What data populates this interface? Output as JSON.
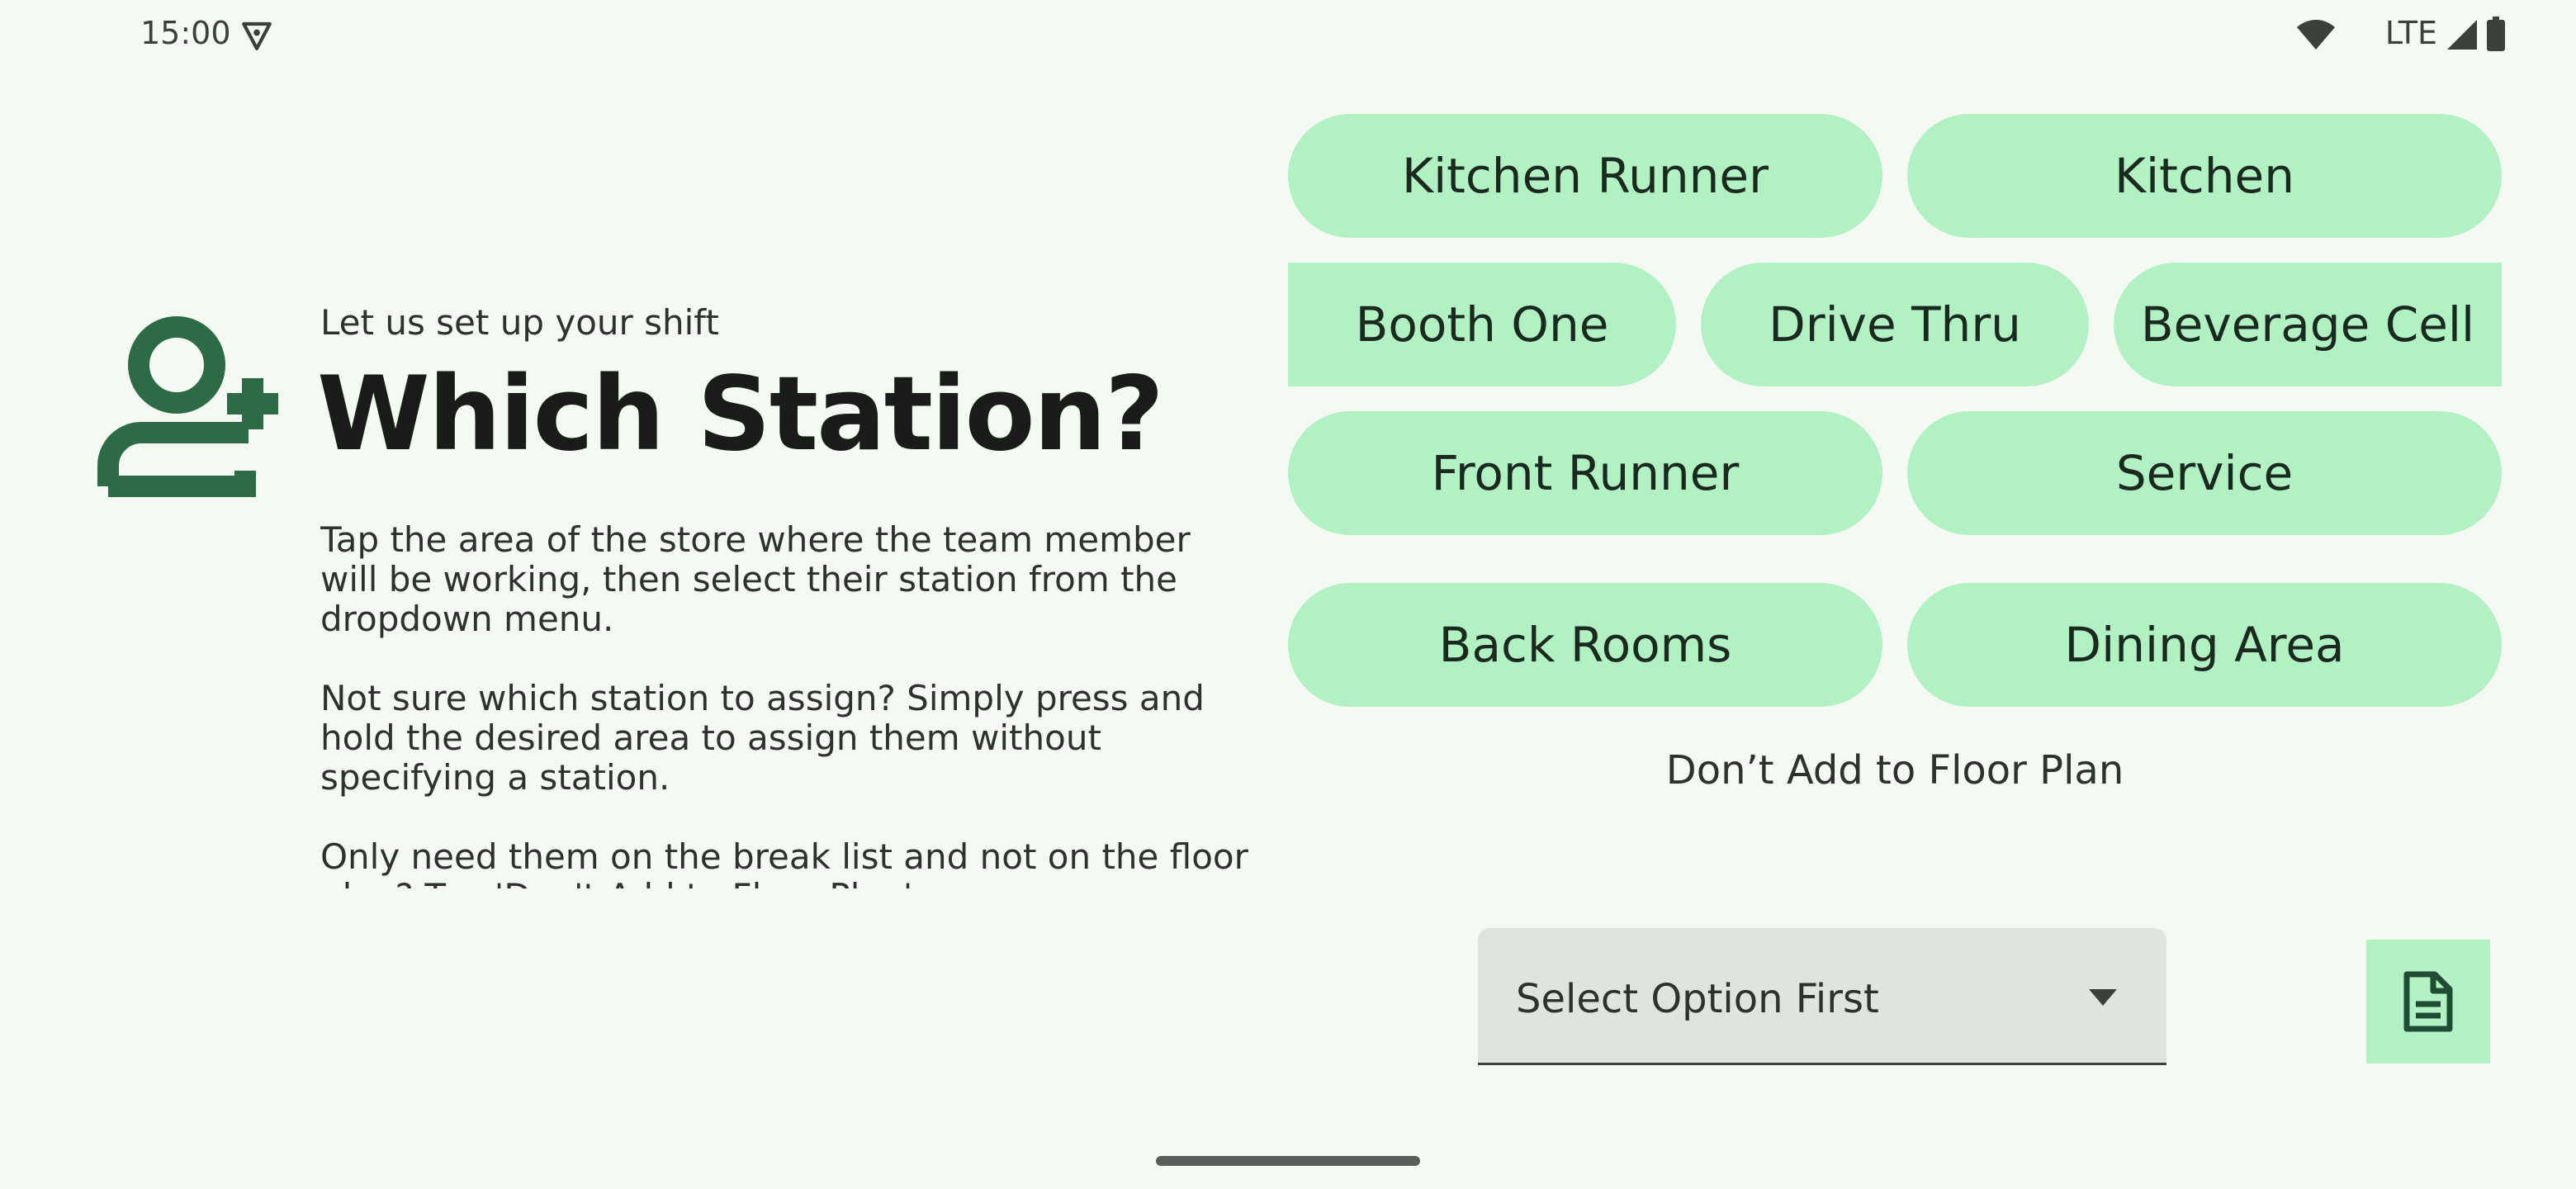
{
  "status_bar": {
    "time": "15:00",
    "network": "LTE",
    "icons": [
      "vpn-icon",
      "wifi-icon",
      "signal-icon",
      "battery-icon"
    ]
  },
  "header": {
    "subtitle": "Let us set up your shift",
    "title": "Which Station?",
    "icon": "person-add-icon"
  },
  "description": [
    "Tap the area of the store where the team member will be working, then select their station from the dropdown menu.",
    "Not sure which station to assign? Simply press and hold the desired area to assign them without specifying a station.",
    "Only need them on the break list and not on the floor plan? Tap 'Don't Add to Floor Plan'."
  ],
  "areas": {
    "kitchen_runner": "Kitchen Runner",
    "kitchen": "Kitchen",
    "booth_one": "Booth One",
    "drive_thru": "Drive Thru",
    "beverage_cell": "Beverage Cell",
    "front_runner": "Front Runner",
    "service": "Service",
    "back_rooms": "Back Rooms",
    "dining_area": "Dining Area"
  },
  "dont_add_label": "Don’t Add to Floor Plan",
  "station_select": {
    "value": "Select Option First",
    "icon": "dropdown-arrow-icon"
  },
  "doc_button_icon": "document-icon",
  "colors": {
    "background": "#f4faf2",
    "chip": "#b2f1c4",
    "accent": "#2d6a46",
    "select_bg": "#dfe4de"
  }
}
